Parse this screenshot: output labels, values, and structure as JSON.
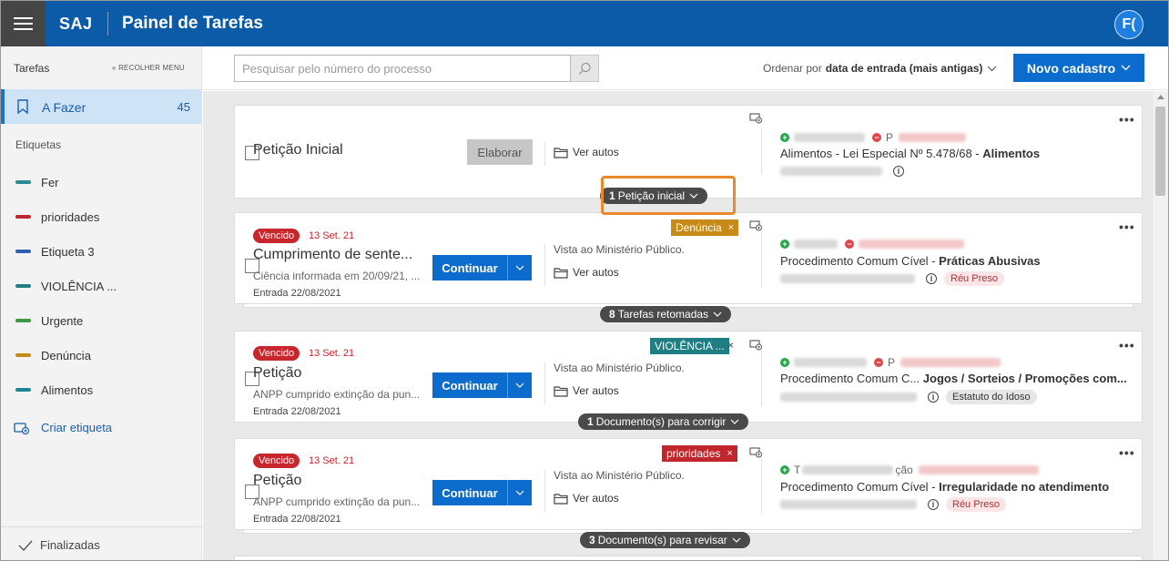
{
  "header": {
    "brand": "SAJ",
    "title": "Painel de Tarefas",
    "avatar": "F("
  },
  "sidebar": {
    "heading": "Tarefas",
    "collapse": "RECOLHER MENU",
    "active": {
      "label": "A Fazer",
      "count": "45"
    },
    "tags_title": "Etiquetas",
    "tags": [
      {
        "label": "Fer",
        "color": "#2a8a96"
      },
      {
        "label": "prioridades",
        "color": "#c0262c"
      },
      {
        "label": "Etiqueta 3",
        "color": "#2c5fb5"
      },
      {
        "label": "VIOLÊNCIA ...",
        "color": "#1f7e83"
      },
      {
        "label": "Urgente",
        "color": "#3a9a42"
      },
      {
        "label": "Denúncia",
        "color": "#c88a16"
      },
      {
        "label": "Alimentos",
        "color": "#1c8494"
      }
    ],
    "create": "Criar etiqueta",
    "finished": "Finalizadas"
  },
  "toolbar": {
    "search_placeholder": "Pesquisar pelo número do processo",
    "order_prefix": "Ordenar por",
    "order_value": "data de entrada (mais antigas)",
    "new_label": "Novo cadastro"
  },
  "cards": [
    {
      "title": "Petição Inicial",
      "action": "Elaborar",
      "view": "Ver autos",
      "party_text": "P",
      "classe": "Alimentos - Lei Especial Nº 5.478/68 - ",
      "assunto": "Alimentos",
      "pill_count": "1",
      "pill_label": "Petição inicial"
    },
    {
      "expired": "Vencido",
      "date": "13 Set. 21",
      "title": "Cumprimento de sente...",
      "subtitle": "Ciência informada em 20/09/21, ...",
      "entry": "Entrada 22/08/2021",
      "action": "Continuar",
      "status": "Vista ao Ministério Público.",
      "view": "Ver autos",
      "tag": {
        "label": "Denúncia",
        "color": "#c88a16"
      },
      "classe": "Procedimento Comum Cível - ",
      "assunto": "Práticas Abusivas",
      "badge": "Réu Preso",
      "pill_count": "8",
      "pill_label": "Tarefas retomadas"
    },
    {
      "expired": "Vencido",
      "date": "13 Set. 21",
      "title": "Petição",
      "subtitle": "ANPP cumprido extinção da pun...",
      "entry": "Entrada 22/08/2021",
      "action": "Continuar",
      "status": "Vista ao Ministério Público.",
      "view": "Ver autos",
      "tag": {
        "label": "VIOLÊNCIA ...",
        "color": "#1f7e83"
      },
      "party_text": "P",
      "classe": "Procedimento Comum C... ",
      "assunto": "Jogos / Sorteios / Promoções com...",
      "badge": "Estatuto do Idoso",
      "pill_count": "1",
      "pill_label": "Documento(s) para corrigir"
    },
    {
      "expired": "Vencido",
      "date": "13 Set. 21",
      "title": "Petição",
      "subtitle": "ANPP cumprido extinção da pun...",
      "entry": "Entrada 22/08/2021",
      "action": "Continuar",
      "status": "Vista ao Ministério Público.",
      "view": "Ver autos",
      "tag": {
        "label": "prioridades",
        "color": "#c0262c"
      },
      "party_text": "T",
      "party_text2": "ção",
      "classe": "Procedimento Comum Cível - ",
      "assunto": "Irregularidade no atendimento",
      "badge": "Réu Preso",
      "pill_count": "3",
      "pill_label": "Documento(s) para revisar"
    }
  ],
  "tag_close": "×",
  "more": "•••",
  "info": "i"
}
